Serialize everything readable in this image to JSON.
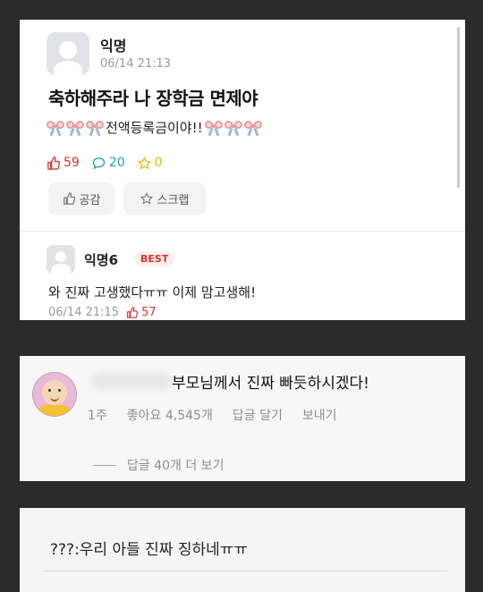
{
  "post": {
    "author": "익명",
    "timestamp": "06/14 21:13",
    "title": "축하해주라 나 장학금 면제야",
    "body_text": "전액등록금이야!!",
    "likes": "59",
    "comments": "20",
    "scraps": "0",
    "like_button": "공감",
    "scrap_button": "스크랩"
  },
  "comment": {
    "author": "익명6",
    "badge": "BEST",
    "text": "와 진짜 고생했다ㅠㅠ 이제 맘고생해!",
    "timestamp": "06/14 21:15",
    "likes": "57"
  },
  "insta_comment": {
    "text": "부모님께서 진짜 빠듯하시겠다!",
    "age": "1주",
    "likes": "좋아요 4,545개",
    "reply": "답글 달기",
    "send": "보내기",
    "more_replies": "답글 40개 더 보기"
  },
  "reply_line": {
    "text": "???:우리 아들 진짜 징하네ㅠㅠ"
  },
  "colors": {
    "like": "#d9342b",
    "comment": "#17a3c4",
    "scrap": "#e6b800"
  }
}
